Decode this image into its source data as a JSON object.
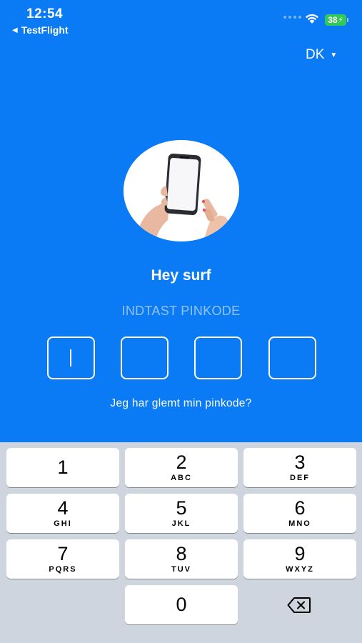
{
  "status_bar": {
    "time": "12:54",
    "back_app": "TestFlight",
    "battery": "38"
  },
  "language": {
    "label": "DK"
  },
  "greeting": "Hey surf",
  "pin": {
    "prompt": "INDTAST PINKODE",
    "length": 4,
    "filled": 0
  },
  "forgot_link": "Jeg har glemt min pinkode?",
  "keypad": {
    "keys": [
      {
        "digit": "1",
        "letters": ""
      },
      {
        "digit": "2",
        "letters": "ABC"
      },
      {
        "digit": "3",
        "letters": "DEF"
      },
      {
        "digit": "4",
        "letters": "GHI"
      },
      {
        "digit": "5",
        "letters": "JKL"
      },
      {
        "digit": "6",
        "letters": "MNO"
      },
      {
        "digit": "7",
        "letters": "PQRS"
      },
      {
        "digit": "8",
        "letters": "TUV"
      },
      {
        "digit": "9",
        "letters": "WXYZ"
      },
      {
        "digit": "0",
        "letters": ""
      }
    ],
    "backspace_icon": "backspace-icon"
  },
  "colors": {
    "background": "#0b7af5",
    "keypad_bg": "#cfd5de",
    "battery": "#34c759"
  }
}
